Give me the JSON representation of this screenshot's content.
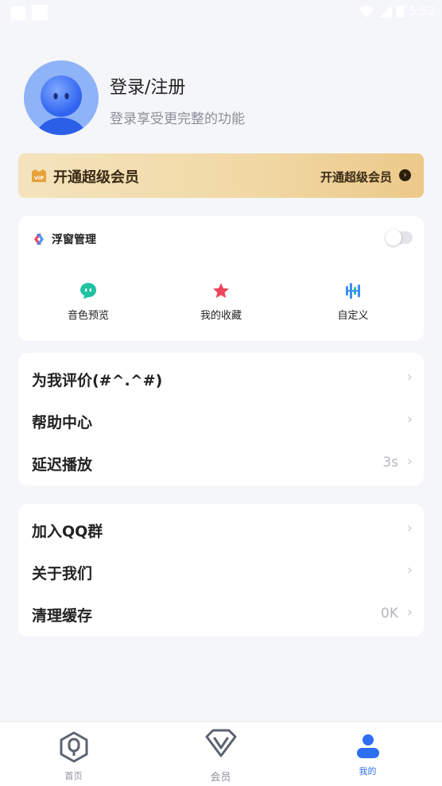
{
  "status_bar": {
    "time": "5:52"
  },
  "profile": {
    "title": "登录/注册",
    "subtitle": "登录享受更完整的功能"
  },
  "vip_banner": {
    "title": "开通超级会员",
    "link_label": "开通超级会员",
    "badge_text": "VIP",
    "colors": {
      "start": "#f4e3bd",
      "end": "#ecc98a"
    }
  },
  "float_window": {
    "title": "浮窗管理",
    "toggle_on": false,
    "items": [
      {
        "label": "音色预览",
        "icon": "chat-bubble-icon",
        "color": "#20c2a2"
      },
      {
        "label": "我的收藏",
        "icon": "star-icon",
        "color": "#f0455e"
      },
      {
        "label": "自定义",
        "icon": "waveform-icon",
        "color": "#3b8cf5"
      }
    ]
  },
  "settings_group_1": [
    {
      "label": "为我评价(#^.^#)",
      "value": ""
    },
    {
      "label": "帮助中心",
      "value": ""
    },
    {
      "label": "延迟播放",
      "value": "3s"
    }
  ],
  "settings_group_2": [
    {
      "label": "加入QQ群",
      "value": ""
    },
    {
      "label": "关于我们",
      "value": ""
    },
    {
      "label": "清理缓存",
      "value": "0K"
    }
  ],
  "tab_bar": {
    "active_color": "#2e6ff2",
    "tabs": [
      {
        "label": "首页",
        "icon": "home-icon",
        "active": false
      },
      {
        "label": "会员",
        "icon": "vip-diamond-icon",
        "active": false
      },
      {
        "label": "我的",
        "icon": "user-icon",
        "active": true
      }
    ]
  }
}
